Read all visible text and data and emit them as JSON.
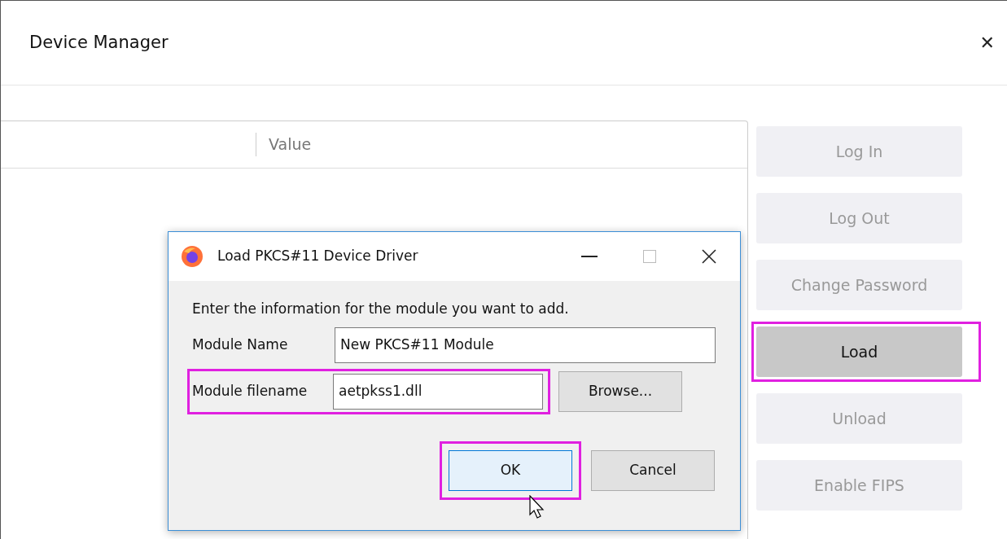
{
  "window": {
    "title": "Device Manager",
    "close": "✕"
  },
  "table": {
    "columns": [
      "Value"
    ]
  },
  "buttons": [
    {
      "label": "Log In",
      "disabled": true,
      "pressed": false,
      "highlighted": false
    },
    {
      "label": "Log Out",
      "disabled": true,
      "pressed": false,
      "highlighted": false
    },
    {
      "label": "Change Password",
      "disabled": true,
      "pressed": false,
      "highlighted": false
    },
    {
      "label": "Load",
      "disabled": false,
      "pressed": true,
      "highlighted": true
    },
    {
      "label": "Unload",
      "disabled": true,
      "pressed": false,
      "highlighted": false
    },
    {
      "label": "Enable FIPS",
      "disabled": true,
      "pressed": false,
      "highlighted": false
    }
  ],
  "dialog": {
    "title": "Load PKCS#11 Device Driver",
    "instruction": "Enter the information for the module you want to add.",
    "fields": [
      {
        "label": "Module Name",
        "value": "New PKCS#11 Module",
        "highlighted": false
      },
      {
        "label": "Module filename",
        "value": "aetpkss1.dll",
        "highlighted": true,
        "button": "Browse..."
      }
    ],
    "actions": [
      {
        "label": "OK",
        "default": true,
        "highlighted": true
      },
      {
        "label": "Cancel",
        "default": false,
        "highlighted": false
      }
    ]
  }
}
